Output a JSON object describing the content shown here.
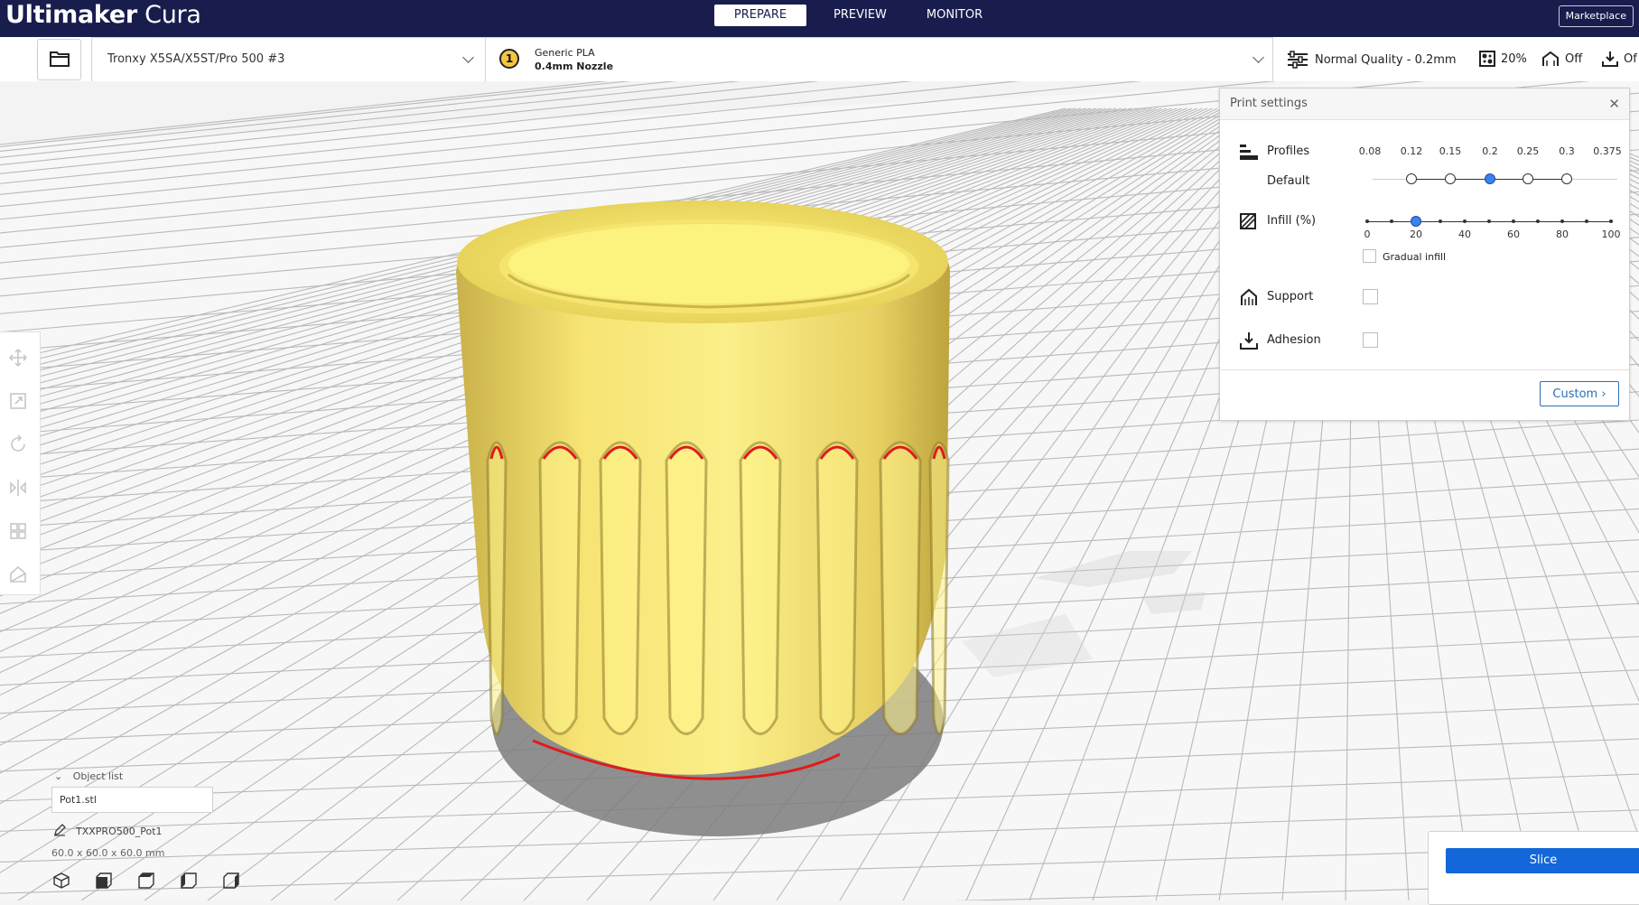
{
  "header": {
    "logo_brand": "Ultimaker",
    "logo_product": "Cura",
    "tabs": [
      {
        "label": "PREPARE",
        "active": true
      },
      {
        "label": "PREVIEW",
        "active": false
      },
      {
        "label": "MONITOR",
        "active": false
      }
    ],
    "marketplace_label": "Marketplace"
  },
  "toolbar": {
    "printer_name": "Tronxy X5SA/X5ST/Pro 500 #3",
    "extruder_number": "1",
    "material_name": "Generic PLA",
    "nozzle": "0.4mm Nozzle",
    "quality": "Normal Quality - 0.2mm",
    "infill": "20%",
    "support": "Off",
    "adhesion": "Of"
  },
  "print_settings": {
    "title": "Print settings",
    "profiles_label": "Profiles",
    "profiles_default_label": "Default",
    "layer_heights": [
      "0.08",
      "0.12",
      "0.15",
      "0.2",
      "0.25",
      "0.3",
      "0.375"
    ],
    "selected_layer_height": "0.2",
    "infill_label": "Infill (%)",
    "infill_ticks": [
      "0",
      "20",
      "40",
      "60",
      "80",
      "100"
    ],
    "infill_value": 20,
    "gradual_infill_label": "Gradual infill",
    "gradual_infill_checked": false,
    "support_label": "Support",
    "support_checked": false,
    "adhesion_label": "Adhesion",
    "adhesion_checked": false,
    "custom_button": "Custom"
  },
  "object_list": {
    "toggle_label": "Object list",
    "filename": "Pot1.stl",
    "object_name": "TXXPRO500_Pot1",
    "dimensions": "60.0 x 60.0 x 60.0 mm"
  },
  "slice": {
    "button_label": "Slice"
  },
  "colors": {
    "header_bg": "#181d4e",
    "accent_blue": "#1467d9",
    "model_yellow": "#f5e26a",
    "overhang_red": "#e01b1b"
  }
}
